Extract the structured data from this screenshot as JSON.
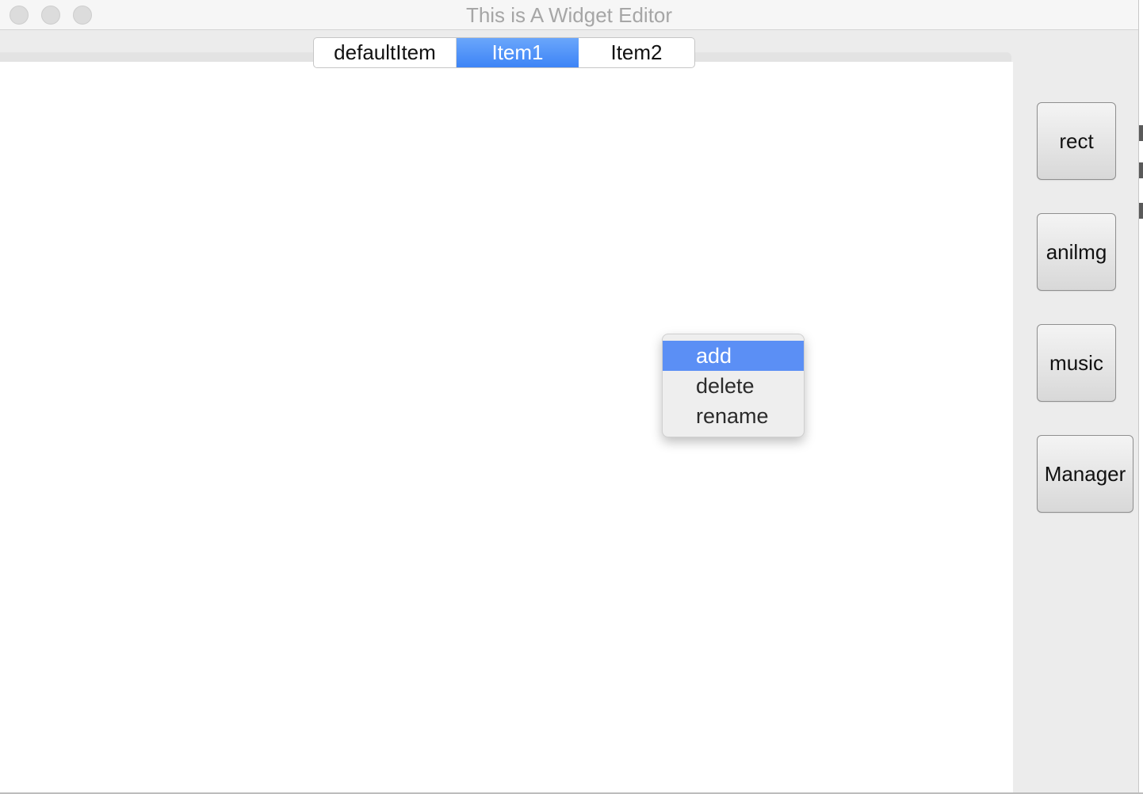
{
  "window": {
    "title": "This is A Widget Editor"
  },
  "tabs": [
    {
      "label": "defaultItem",
      "selected": false
    },
    {
      "label": "Item1",
      "selected": true
    },
    {
      "label": "Item2",
      "selected": false
    }
  ],
  "side_buttons": {
    "rect": "rect",
    "anilmg": "anilmg",
    "music": "music",
    "manager": "Manager"
  },
  "context_menu": {
    "items": [
      {
        "label": "add",
        "selected": true
      },
      {
        "label": "delete",
        "selected": false
      },
      {
        "label": "rename",
        "selected": false
      }
    ]
  },
  "colors": {
    "selection_blue": "#3d84f6",
    "menu_highlight": "#5b8ff5"
  }
}
